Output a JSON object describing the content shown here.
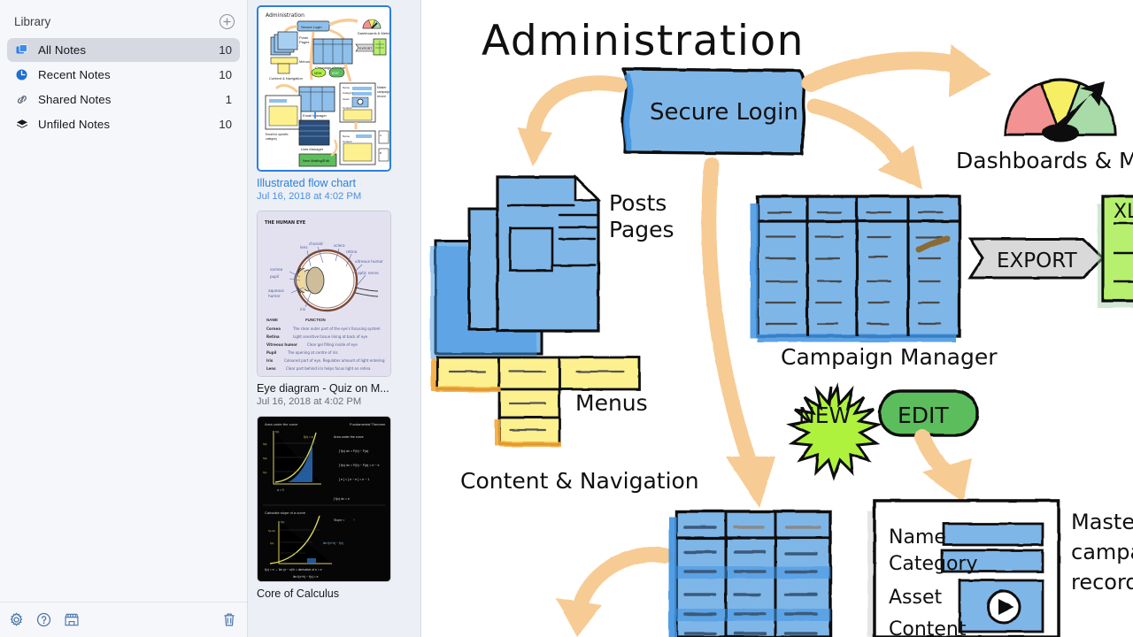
{
  "sidebar": {
    "header": {
      "title": "Library",
      "add_label": "+"
    },
    "items": [
      {
        "label": "All Notes",
        "count": "10",
        "icon": "stacked-squares-icon",
        "selected": true
      },
      {
        "label": "Recent Notes",
        "count": "10",
        "icon": "clock-icon",
        "selected": false
      },
      {
        "label": "Shared Notes",
        "count": "1",
        "icon": "link-icon",
        "selected": false
      },
      {
        "label": "Unfiled Notes",
        "count": "10",
        "icon": "layers-icon",
        "selected": false
      }
    ],
    "toolbar": [
      {
        "name": "settings-button",
        "icon": "gear-icon"
      },
      {
        "name": "help-button",
        "icon": "question-circle-icon"
      },
      {
        "name": "store-button",
        "icon": "store-icon"
      },
      {
        "name": "trash-button",
        "icon": "trash-icon"
      }
    ]
  },
  "notelist": {
    "notes": [
      {
        "title": "Illustrated flow chart",
        "date": "Jul 16, 2018 at 4:02 PM",
        "selected": true,
        "thumb": "flowchart"
      },
      {
        "title": "Eye diagram - Quiz on M...",
        "date": "Jul 16, 2018 at 4:02 PM",
        "selected": false,
        "thumb": "eye"
      },
      {
        "title": "Core of Calculus",
        "date": "",
        "selected": false,
        "thumb": "calculus"
      }
    ]
  },
  "canvas": {
    "title": "Administration",
    "nodes": {
      "secure_login": "Secure Login",
      "dashboards": "Dashboards & Met",
      "posts_pages": "Posts\nPages",
      "posts": "Posts",
      "pages": "Pages",
      "menus": "Menus",
      "content_navigation": "Content & Navigation",
      "campaign_manager": "Campaign Manager",
      "export": "EXPORT",
      "xl_label": "XL",
      "new_badge": "NEW",
      "edit_badge": "EDIT",
      "master_record": "Master\ncampaign\nrecord",
      "master_line1": "Master",
      "master_line2": "campaign",
      "master_line3": "record",
      "field_name": "Name",
      "field_category": "Category",
      "field_asset": "Asset",
      "field_content": "Content"
    },
    "colors": {
      "blue_fill": "#7fb6e8",
      "blue_shadow": "#3f93e3",
      "yellow_fill": "#fdf08f",
      "yellow_shadow": "#f5a836",
      "arrow_fill": "#f7cb94",
      "green_badge": "#5cbd5c",
      "lime_badge": "#aef23d",
      "gauge_red": "#f29292",
      "gauge_yellow": "#f7ef64",
      "gauge_green": "#a8dba8",
      "export_gray": "#d9d9d9",
      "xl_green": "#b6f06e",
      "ink": "#101010"
    },
    "eye_thumb": {
      "heading": "THE HUMAN EYE",
      "labels": [
        "choroid",
        "sclera",
        "retina",
        "lens",
        "vitreous humor",
        "optic nerve",
        "cornea",
        "pupil",
        "aqueous humor",
        "iris"
      ],
      "table_headers": [
        "NAME",
        "FUNCTION"
      ],
      "table_rows": [
        [
          "Cornea",
          "The clear outer part of the eye's focusing system"
        ],
        [
          "Retina",
          "Light sensitive tissue lining at back of eye"
        ],
        [
          "Vitreous humor",
          "Clear gel filling inside of eye"
        ],
        [
          "Pupil",
          "The opening at centre of iris"
        ],
        [
          "Iris",
          "Coloured part of eye. Regulates amount of light entering"
        ],
        [
          "Lens",
          "Clear part behind iris helps focus light on retina"
        ]
      ]
    }
  }
}
